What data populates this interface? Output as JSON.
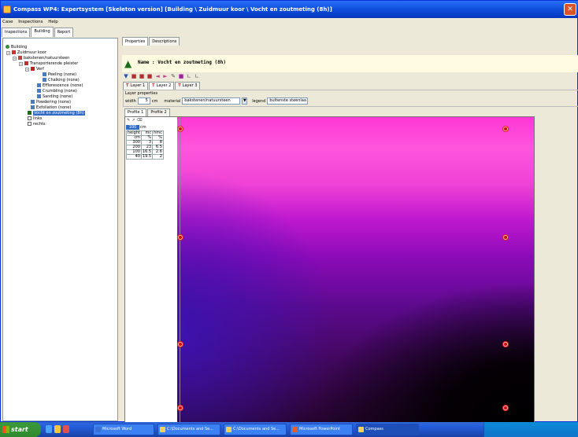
{
  "window": {
    "title": "Compass WP4: Expertsystem [Skeleton version] [Building \\ Zuidmuur koor \\ Vocht en zoutmeting (8h)]",
    "close_glyph": "✕"
  },
  "menu": [
    "Case",
    "Inspections",
    "Help"
  ],
  "nav_tabs": [
    "Inspections",
    "Building",
    "Report"
  ],
  "tree": [
    {
      "label": "Building",
      "level": 0,
      "icon": "building-icon"
    },
    {
      "label": "Zuidmuur koor",
      "level": 1,
      "icon": "wall-icon"
    },
    {
      "label": "bakstenen/natuursteen",
      "level": 2,
      "icon": "material-icon"
    },
    {
      "label": "Transporterende pleister",
      "level": 3,
      "icon": "layer-icon"
    },
    {
      "label": "Verf",
      "level": 4,
      "icon": "paint-icon"
    },
    {
      "label": "Peeling (none)",
      "level": 5,
      "icon": "damage-icon"
    },
    {
      "label": "Chalking (none)",
      "level": 5,
      "icon": "damage-icon"
    },
    {
      "label": "Efflorescence (none)",
      "level": 4,
      "icon": "damage-icon"
    },
    {
      "label": "Crumbling (none)",
      "level": 4,
      "icon": "damage-icon"
    },
    {
      "label": "Sanding (none)",
      "level": 4,
      "icon": "damage-icon"
    },
    {
      "label": "Powdering (none)",
      "level": 3,
      "icon": "damage-icon"
    },
    {
      "label": "Exfoliation (none)",
      "level": 3,
      "icon": "damage-icon"
    },
    {
      "label": "Vocht en zoutmeting (8h)",
      "level": 1,
      "icon": "measurement-icon",
      "selected": true
    },
    {
      "label": "links",
      "level": 1,
      "icon": "checkbox-icon"
    },
    {
      "label": "rechts",
      "level": 1,
      "icon": "checkbox-icon"
    }
  ],
  "props_tabs": [
    "Properties",
    "Descriptions"
  ],
  "name_line": "Name : Vocht en zoutmeting (8h)",
  "layer_tabs": [
    "Layer 1",
    "Layer 2",
    "Layer 3"
  ],
  "layer_properties": {
    "title": "Layer properties",
    "width_label": "width",
    "width_value": "5",
    "width_unit": "cm",
    "material_label": "material",
    "material_value": "bakstenen/natuursteen",
    "legend_label": "legend",
    "legend_value": "buitenste steenlaa"
  },
  "profile_tabs": [
    "Profile 1",
    "Profile 2"
  ],
  "table": {
    "header_value": "100",
    "header_unit": "cm",
    "columns": [
      [
        "height",
        "cm"
      ],
      [
        "mc",
        "%"
      ],
      [
        "hmc",
        "%"
      ]
    ],
    "rows": [
      [
        "300",
        "3",
        "8"
      ],
      [
        "200",
        "23",
        "6.5"
      ],
      [
        "100",
        "16.5",
        "2.6"
      ],
      [
        "40",
        "19.5",
        "2"
      ]
    ]
  },
  "taskbar": {
    "start_label": "start",
    "items": [
      "Microsoft Word",
      "C:\\Documents and Se...",
      "C:\\Documents and Se...",
      "Microsoft PowerPoint",
      "Compass"
    ]
  },
  "colors": {
    "heatmap_top": "#ff37d4",
    "heatmap_mid": "#8c0ab8",
    "heatmap_low_left": "#3c12b0",
    "heatmap_dark": "#000000",
    "title_blue": "#0a48d8",
    "selection": "#316ac5"
  }
}
